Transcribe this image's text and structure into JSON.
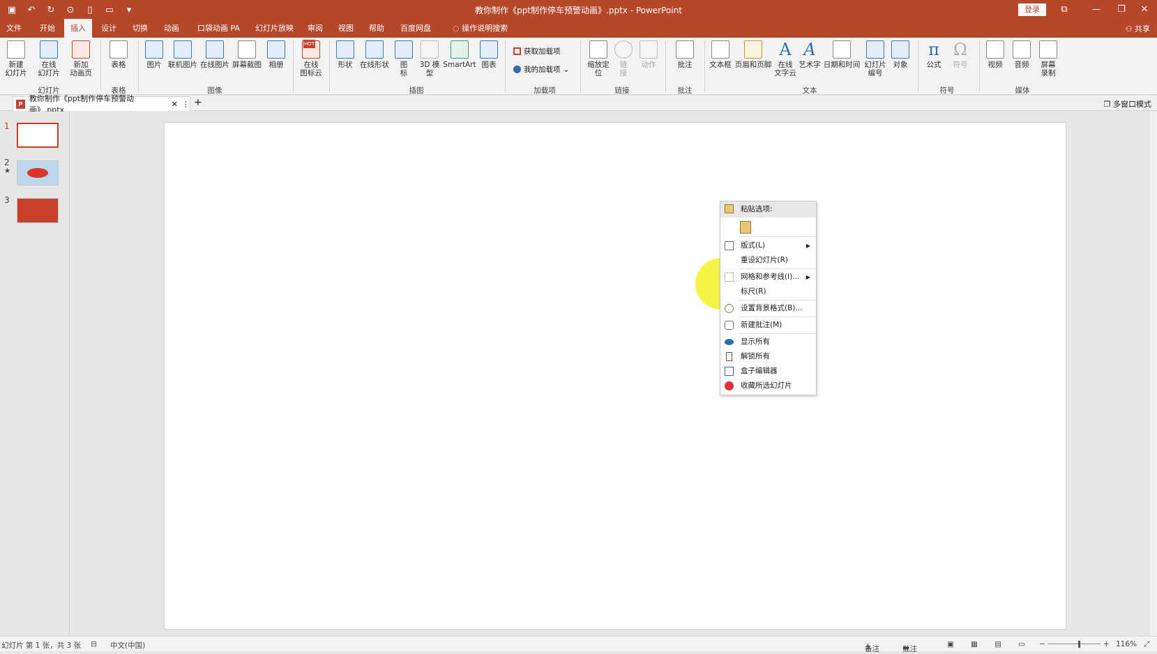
{
  "window": {
    "title": "教你制作《ppt制作停车预警动画》.pptx  -  PowerPoint",
    "login": "登录",
    "controls": [
      "⧉",
      "—",
      "❐",
      "✕"
    ]
  },
  "menu": {
    "tabs": [
      "文件",
      "开始",
      "插入",
      "设计",
      "切换",
      "动画",
      "口袋动画 PA",
      "幻灯片放映",
      "审阅",
      "视图",
      "帮助",
      "百度网盘",
      "操作说明搜索"
    ],
    "active": "插入",
    "share": "共享"
  },
  "ribbon": {
    "slides": {
      "new_slide": "新建\n幻灯片",
      "online_slide": "在线\n幻灯片",
      "new_anim": "新加\n动画页",
      "label": "幻灯片"
    },
    "tables": {
      "table": "表格",
      "label": "表格"
    },
    "images": {
      "picture": "图片",
      "online_picture": "联机图片",
      "online_img": "在线图片",
      "screenshot": "屏幕截图",
      "album": "相册",
      "label": "图像"
    },
    "iconcloud": {
      "label_btn": "在线\n图标云",
      "hot": "HOT"
    },
    "illustrations": {
      "shape": "形状",
      "online_shape": "在线形状",
      "icon": "图\n标",
      "model3d": "3D 模\n型",
      "smartart": "SmartArt",
      "chart": "图表",
      "label": "插图"
    },
    "addins": {
      "get": "获取加载项",
      "my": "我的加载项",
      "label": "加载项"
    },
    "links": {
      "zoom": "缩放定\n位",
      "link": "链\n接",
      "action": "动作",
      "label": "链接"
    },
    "comments": {
      "comment": "批注",
      "label": "批注"
    },
    "text": {
      "textbox": "文本框",
      "header": "页眉和页脚",
      "wordcloud": "在线\n文字云",
      "wordart": "艺术字",
      "datetime": "日期和时间",
      "slidenum": "幻灯片\n编号",
      "object": "对象",
      "label": "文本"
    },
    "symbols": {
      "equation": "公式",
      "symbol": "符号",
      "label": "符号",
      "pi": "π",
      "omega": "Ω"
    },
    "media": {
      "video": "视频",
      "audio": "音频",
      "record": "屏幕\n录制",
      "label": "媒体"
    }
  },
  "doc_tab": {
    "name": "教你制作《ppt制作停车预警动画》.pptx",
    "close": "✕",
    "more": "⋮",
    "add": "+"
  },
  "multi_window": "多窗口模式",
  "thumbnails": [
    {
      "num": "1"
    },
    {
      "num": "2",
      "mark": "★"
    },
    {
      "num": "3"
    }
  ],
  "context_menu": {
    "header": "粘贴选项:",
    "items": [
      "版式(L)",
      "重设幻灯片(R)",
      "网格和参考线(I)...",
      "标尺(R)",
      "设置背景格式(B)...",
      "新建批注(M)",
      "显示所有",
      "解锁所有",
      "盒子编辑器",
      "收藏所选幻灯片"
    ],
    "submenu_arrow": "▶"
  },
  "status": {
    "slide_info": "幻灯片 第 1 张，共 3 张",
    "language": "中文(中国)",
    "notes": "备注",
    "comments": "批注",
    "zoom": "116%"
  },
  "colors": {
    "accent": "#b7472a",
    "ribbon_bg": "#f3f3f3",
    "canvas_bg": "#e6e6e6",
    "highlight": "#f0f000"
  }
}
